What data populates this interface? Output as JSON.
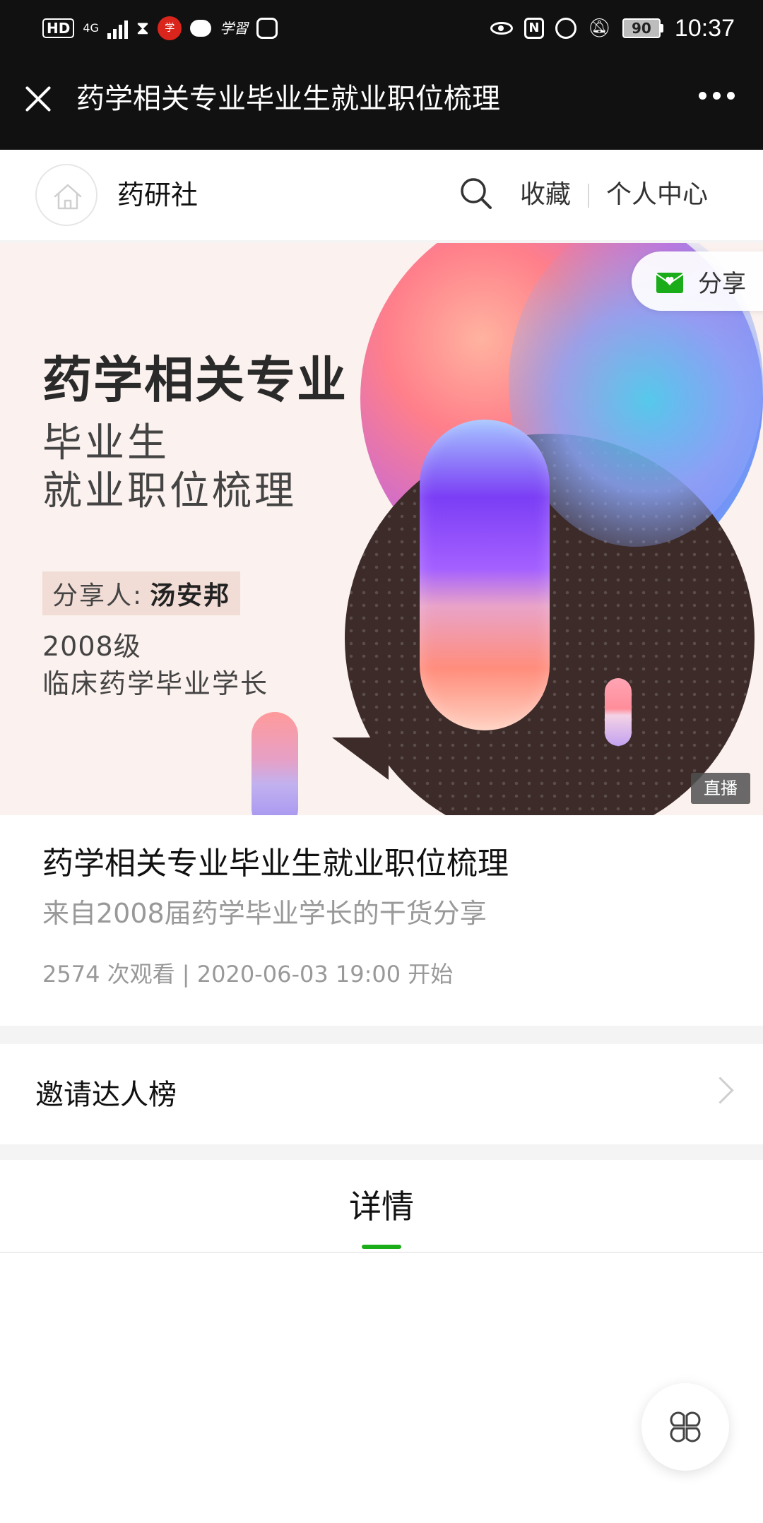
{
  "status_bar": {
    "hd": "HD",
    "network": "4G",
    "app1": "学",
    "app2": "学習",
    "battery": "90",
    "time": "10:37"
  },
  "title_bar": {
    "title": "药学相关专业毕业生就业职位梳理"
  },
  "shop_header": {
    "name": "药研社",
    "favorites": "收藏",
    "personal_center": "个人中心"
  },
  "banner": {
    "heading": "药学相关专业",
    "subtitle_line1": "毕业生",
    "subtitle_line2": "就业职位梳理",
    "speaker_label": "分享人:",
    "speaker_name": "汤安邦",
    "grade": "2008级",
    "role": "临床药学毕业学长",
    "share_label": "分享",
    "live_badge": "直播"
  },
  "course": {
    "title": "药学相关专业毕业生就业职位梳理",
    "subtitle": "来自2008届药学毕业学长的干货分享",
    "meta": "2574 次观看 | 2020-06-03 19:00 开始"
  },
  "invite": {
    "label": "邀请达人榜"
  },
  "tabs": {
    "active": "详情"
  },
  "colors": {
    "accent_green": "#1aad19",
    "bar_dark": "#111111",
    "muted_text": "#999999"
  }
}
